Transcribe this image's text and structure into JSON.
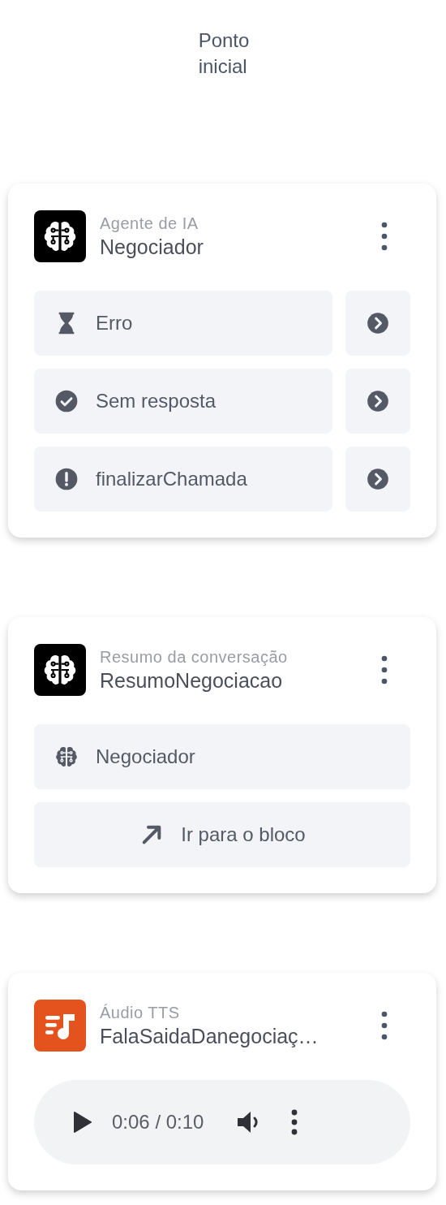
{
  "start_label": "Ponto\ninicial",
  "cards": [
    {
      "kind": "outputs",
      "subtitle": "Agente de IA",
      "title": "Negociador",
      "rows": [
        {
          "label": "Erro"
        },
        {
          "label": "Sem resposta"
        },
        {
          "label": "finalizarChamada"
        }
      ]
    },
    {
      "kind": "links",
      "subtitle": "Resumo da conversação",
      "title": "ResumoNegociacao",
      "rows": [
        {
          "kind": "agent",
          "label": "Negociador"
        },
        {
          "kind": "jump",
          "label": "Ir para o bloco"
        }
      ]
    },
    {
      "kind": "audio",
      "subtitle": "Áudio TTS",
      "title": "FalaSaidaDanegociaç…",
      "time": "0:06 / 0:10"
    }
  ]
}
